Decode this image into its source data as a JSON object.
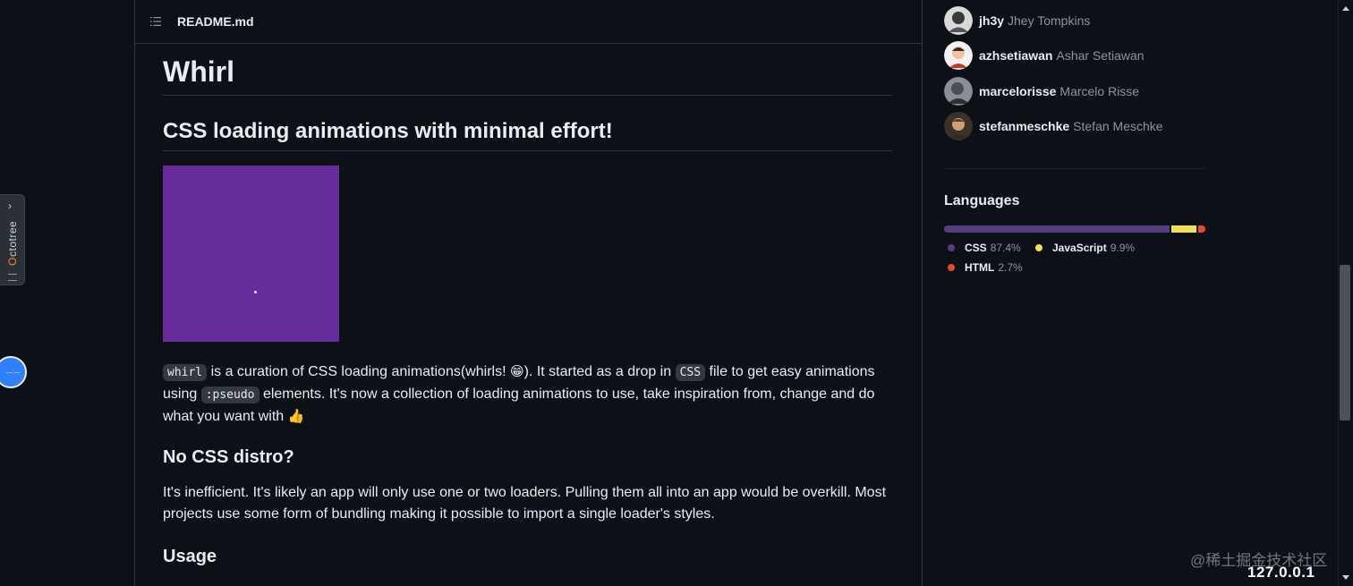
{
  "readme": {
    "filename": "README.md",
    "title": "Whirl",
    "subtitle": "CSS loading animations with minimal effort!",
    "intro": {
      "code_whirl": "whirl",
      "text1": " is a curation of CSS loading animations(whirls! ",
      "emoji1": "😁",
      "text2": "). It started as a drop in ",
      "code_css": "CSS",
      "text3": " file to get easy animations using ",
      "code_pseudo": ":pseudo",
      "text4": " elements. It's now a collection of loading animations to use, take inspiration from, change and do what you want with ",
      "emoji2": "👍"
    },
    "section_no_css": "No CSS distro?",
    "no_css_text": "It's inefficient. It's likely an app will only use one or two loaders. Pulling them all into an app would be overkill. Most projects use some form of bundling making it possible to import a single loader's styles.",
    "section_usage": "Usage",
    "demo_color": "#662d9a"
  },
  "octotree": {
    "label_o": "O",
    "label_rest": "ctotree",
    "chevron": "›"
  },
  "float_button": {
    "label": "—:—"
  },
  "contributors": [
    {
      "username": "jh3y",
      "fullname": "Jhey Tompkins"
    },
    {
      "username": "azhsetiawan",
      "fullname": "Ashar Setiawan"
    },
    {
      "username": "marcelorisse",
      "fullname": "Marcelo Risse"
    },
    {
      "username": "stefanmeschke",
      "fullname": "Stefan Meschke"
    }
  ],
  "languages": {
    "title": "Languages",
    "items": [
      {
        "name": "CSS",
        "percent": "87.4%",
        "value": 87.4,
        "color": "#563d7c"
      },
      {
        "name": "JavaScript",
        "percent": "9.9%",
        "value": 9.9,
        "color": "#f1e05a"
      },
      {
        "name": "HTML",
        "percent": "2.7%",
        "value": 2.7,
        "color": "#e34c26"
      }
    ]
  },
  "overlay": {
    "watermark": "@稀土掘金技术社区",
    "host": "127.0.0.1"
  }
}
